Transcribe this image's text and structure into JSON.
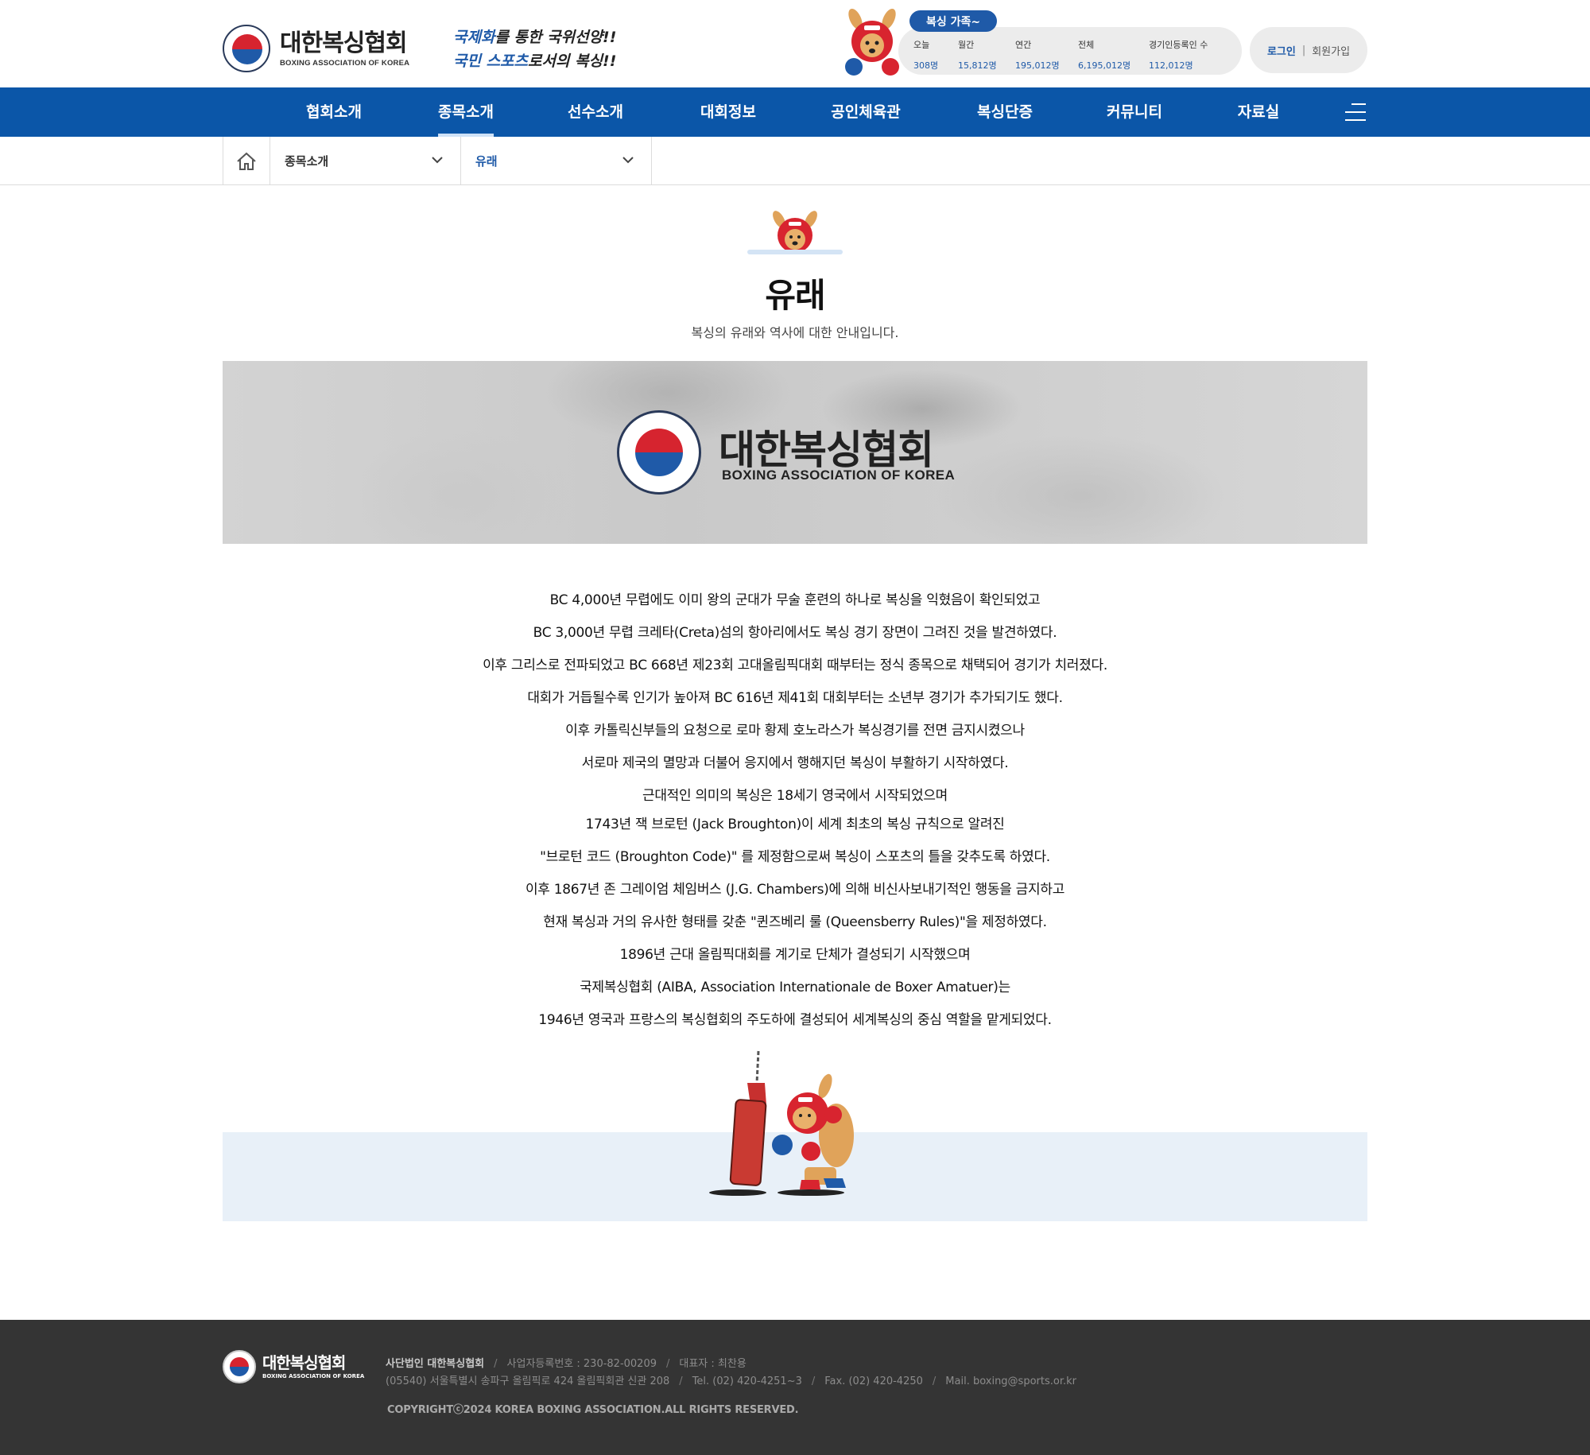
{
  "header": {
    "logo_ko": "대한복싱협회",
    "logo_en": "BOXING ASSOCIATION OF KOREA",
    "slogan_line1_hl": "국제화",
    "slogan_line1_rest": "를 통한 국위선양!!",
    "slogan_line2_hl": "국민 스포츠",
    "slogan_line2_rest": "로서의 복싱!!",
    "family_pill": "복싱 가족~",
    "stats": [
      {
        "label": "오늘",
        "value": "308명"
      },
      {
        "label": "월간",
        "value": "15,812명"
      },
      {
        "label": "연간",
        "value": "195,012명"
      },
      {
        "label": "전체",
        "value": "6,195,012명"
      },
      {
        "label": "경기인등록인 수",
        "value": "112,012명"
      }
    ],
    "login": "로그인",
    "join": "회원가입"
  },
  "nav": {
    "items": [
      "협회소개",
      "종목소개",
      "선수소개",
      "대회정보",
      "공인체육관",
      "복싱단증",
      "커뮤니티",
      "자료실"
    ],
    "active": "종목소개"
  },
  "breadcrumb": {
    "level1": "종목소개",
    "level2": "유래"
  },
  "page": {
    "title": "유래",
    "subtitle": "복싱의 유래와 역사에 대한 안내입니다."
  },
  "banner": {
    "ko": "대한복싱협회",
    "en": "BOXING ASSOCIATION OF KOREA"
  },
  "content": {
    "lines": [
      "BC 4,000년 무렵에도 이미 왕의 군대가 무술 훈련의 하나로 복싱을 익혔음이 확인되었고",
      "BC 3,000년 무렵 크레타(Creta)섬의 항아리에서도 복싱 경기 장면이 그려진 것을 발견하였다.",
      "이후 그리스로 전파되었고 BC 668년 제23회 고대올림픽대회 때부터는 정식 종목으로 채택되어 경기가 치러졌다.",
      "대회가 거듭될수록 인기가 높아져 BC 616년 제41회 대회부터는 소년부 경기가 추가되기도 했다.",
      "이후 카톨릭신부들의 요청으로 로마 황제 호노라스가 복싱경기를 전면 금지시켰으나",
      "서로마 제국의 멸망과 더불어 응지에서 행해지던 복싱이 부활하기 시작하였다.",
      "근대적인 의미의 복싱은 18세기 영국에서 시작되었으며",
      "1743년 잭 브로턴 (Jack Broughton)이 세계 최초의 복싱 규칙으로 알려진",
      "\"브로턴 코드 (Broughton Code)\" 를 제정함으로써 복싱이 스포츠의 틀을 갖추도록 하였다.",
      "이후 1867년 존 그레이엄 체임버스 (J.G. Chambers)에 의해 비신사보내기적인 행동을 금지하고",
      "현재 복싱과 거의 유사한 형태를 갖춘 \"퀸즈베리 룰 (Queensberry Rules)\"을 제정하였다.",
      "1896년 근대 올림픽대회를 계기로 단체가 결성되기 시작했으며",
      "국제복싱협회 (AIBA, Association Internationale de Boxer Amatuer)는",
      "1946년 영국과 프랑스의 복싱협회의 주도하에 결성되어 세계복싱의 중심 역할을 맡게되었다."
    ]
  },
  "footer": {
    "logo_ko": "대한복싱협회",
    "logo_en": "BOXING ASSOCIATION OF KOREA",
    "corp": "사단법인 대한복싱협회",
    "biz_no": "사업자등록번호 : 230-82-00209",
    "ceo": "대표자 : 최찬용",
    "address": "(05540) 서울특별시 송파구 올림픽로 424 올림픽회관 신관 208",
    "tel": "Tel. (02) 420-4251~3",
    "fax": "Fax. (02) 420-4250",
    "mail": "Mail. boxing@sports.or.kr",
    "copyright": "COPYRIGHTⓒ2024 KOREA BOXING ASSOCIATION.ALL RIGHTS RESERVED."
  },
  "colors": {
    "brand_blue": "#0b56a8",
    "accent_blue": "#1f5aa8",
    "footer_bg": "#343434",
    "band_bg": "#e8f0f8"
  }
}
